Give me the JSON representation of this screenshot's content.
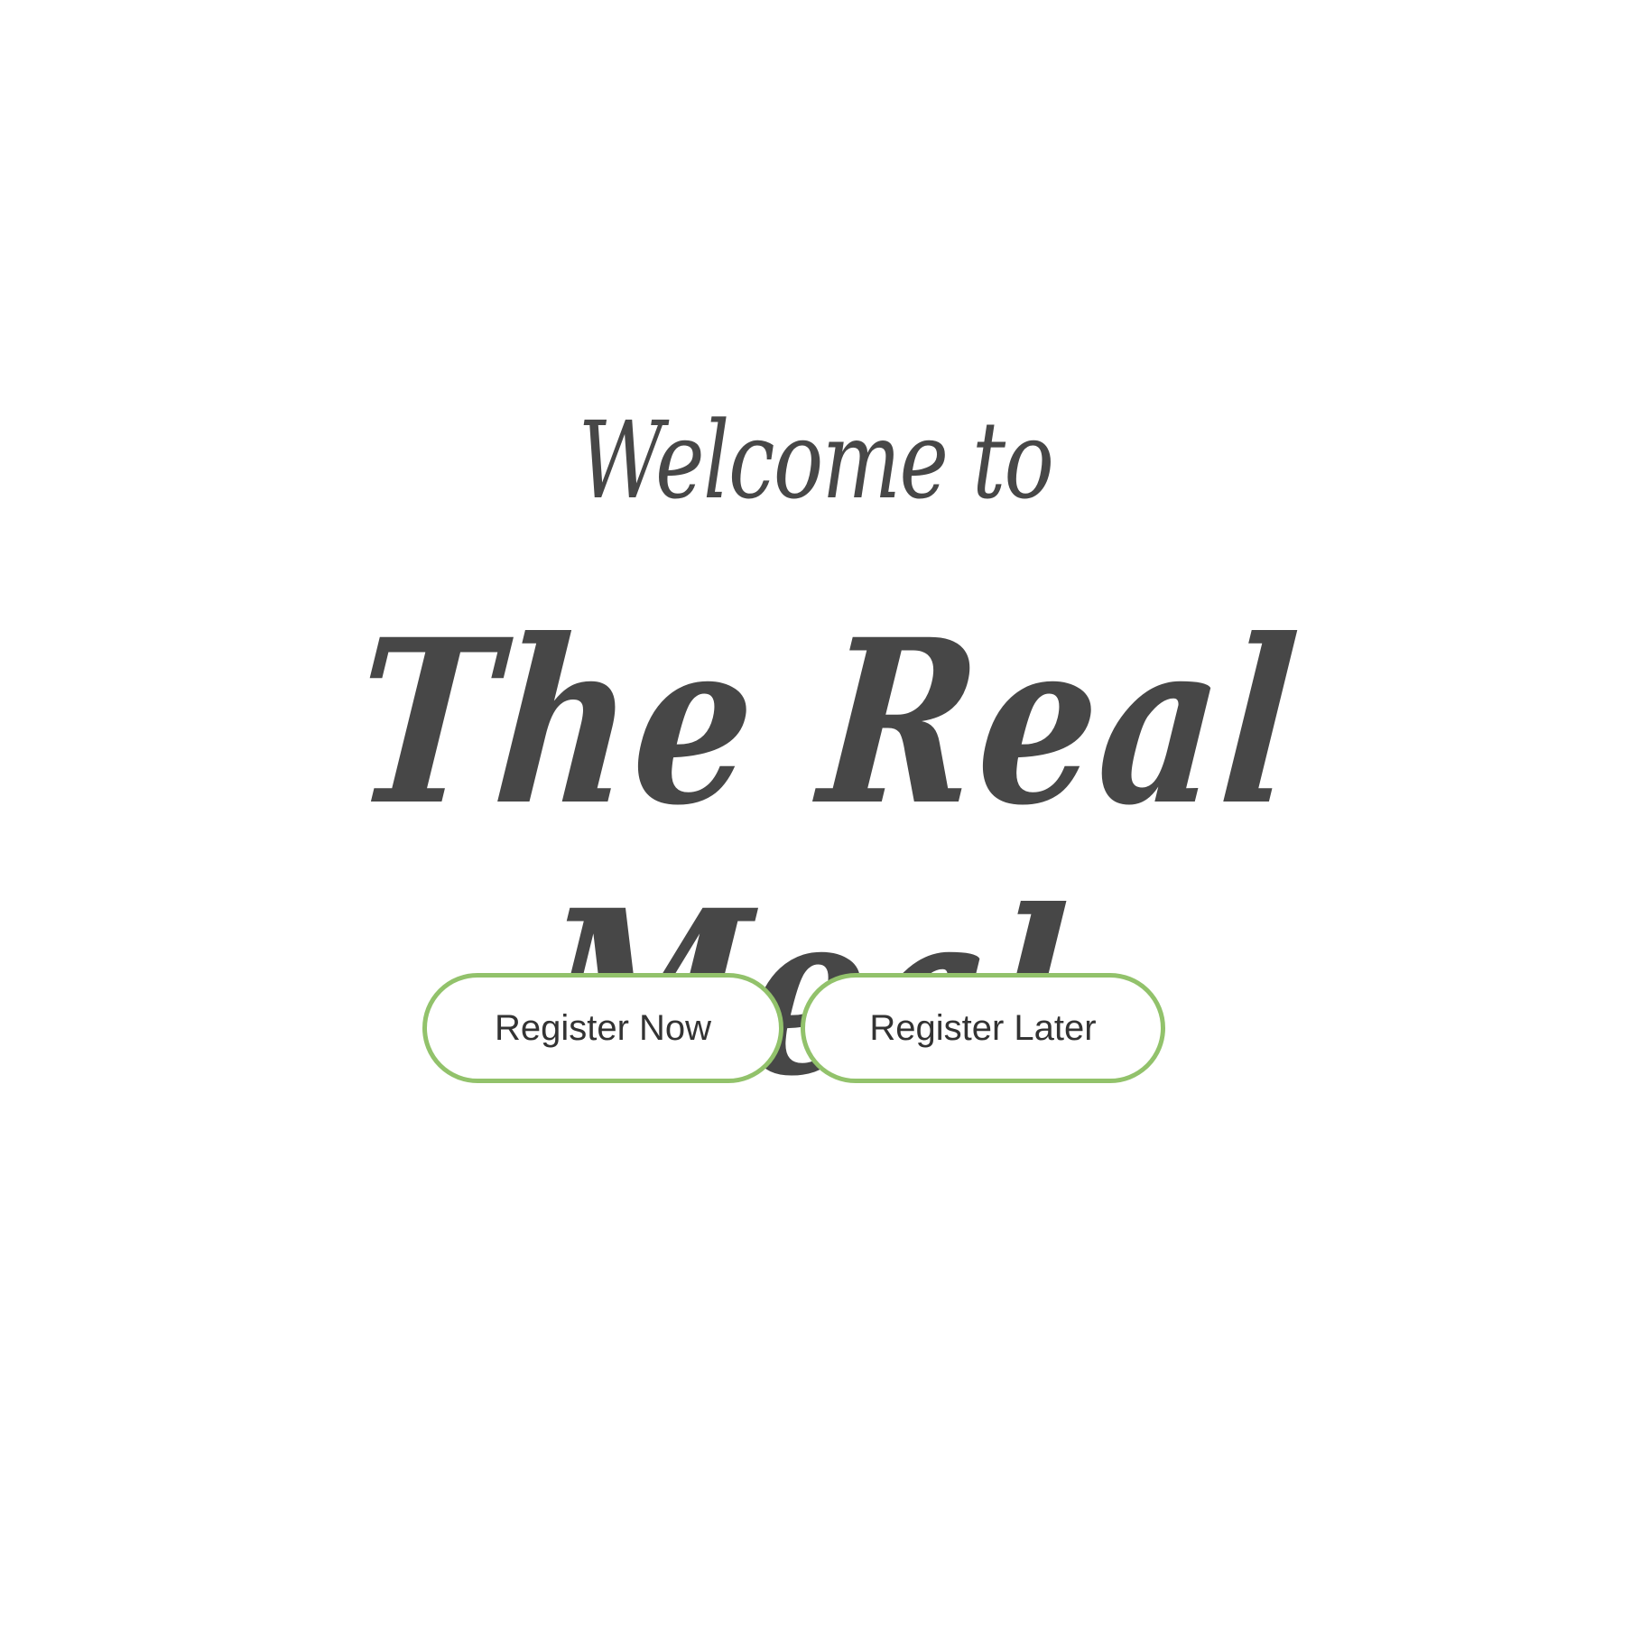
{
  "header": {
    "welcome": "Welcome to",
    "app_name": "The Real Meal"
  },
  "actions": {
    "register_now": "Register Now",
    "register_later": "Register Later"
  },
  "colors": {
    "accent": "#92c26b",
    "text": "#474747",
    "background": "#ffffff"
  }
}
